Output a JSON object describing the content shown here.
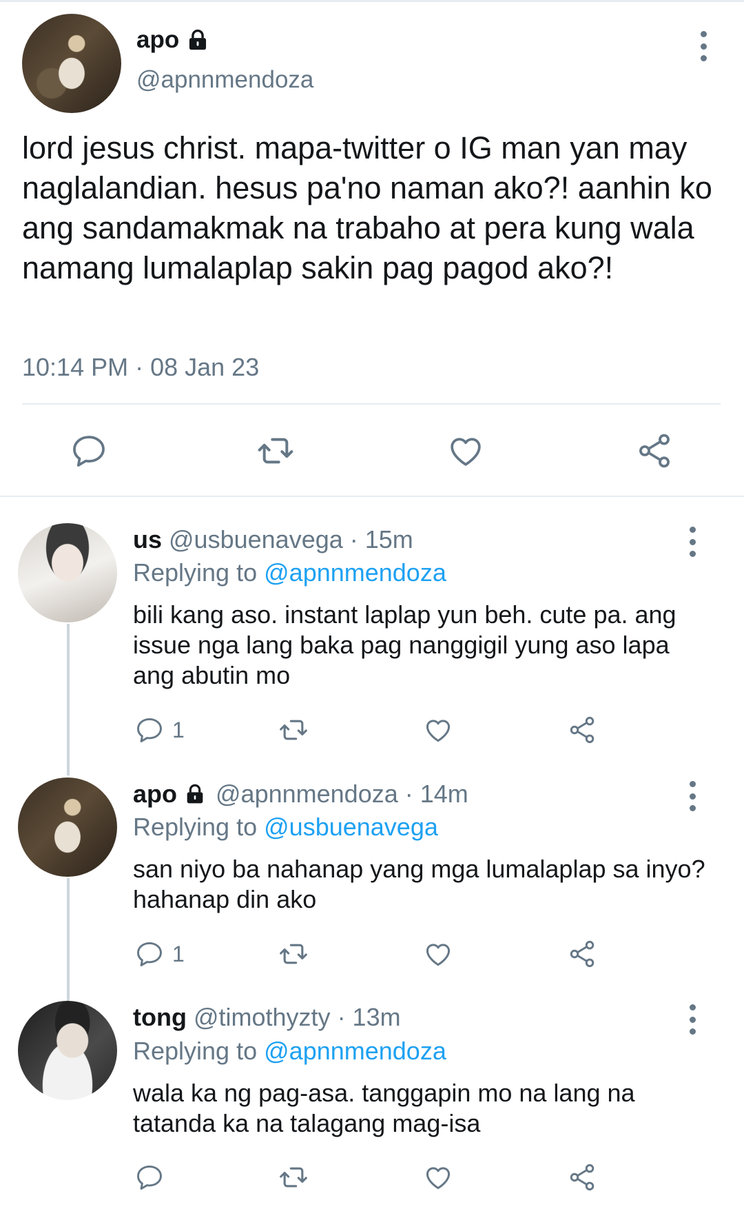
{
  "main_tweet": {
    "name": "apo",
    "handle": "@apnnmendoza",
    "text": "lord jesus christ. mapa-twitter o IG man yan may naglalandian. hesus pa'no naman ako?! aanhin ko ang sandamakmak na trabaho at pera kung wala namang lumalaplap sakin pag pagod ako?!",
    "timestamp": "10:14 PM · 08 Jan 23"
  },
  "replies": [
    {
      "name": "us",
      "handle": "@usbuenavega",
      "time": "· 15m",
      "replying_label": "Replying to",
      "replying_to": "@apnnmendoza",
      "text": "bili kang aso. instant laplap yun beh. cute pa. ang issue nga lang baka pag nanggigil yung aso lapa ang abutin mo",
      "reply_count": "1",
      "locked": false
    },
    {
      "name": "apo",
      "handle": "@apnnmendoza",
      "time": "· 14m",
      "replying_label": "Replying to",
      "replying_to": "@usbuenavega",
      "text": "san niyo ba nahanap yang mga lumalaplap sa inyo? hahanap din ako",
      "reply_count": "1",
      "locked": true
    },
    {
      "name": "tong",
      "handle": "@timothyzty",
      "time": "· 13m",
      "replying_label": "Replying to",
      "replying_to": "@apnnmendoza",
      "text": "wala ka ng pag-asa. tanggapin mo na lang na tatanda ka na talagang mag-isa",
      "reply_count": "",
      "locked": false
    }
  ],
  "icons": [
    "lock-icon",
    "more-icon",
    "reply-icon",
    "retweet-icon",
    "like-icon",
    "share-icon"
  ],
  "colors": {
    "text": "#14171a",
    "secondary": "#657786",
    "link": "#1da1f2",
    "divider": "#e6ecf0"
  }
}
